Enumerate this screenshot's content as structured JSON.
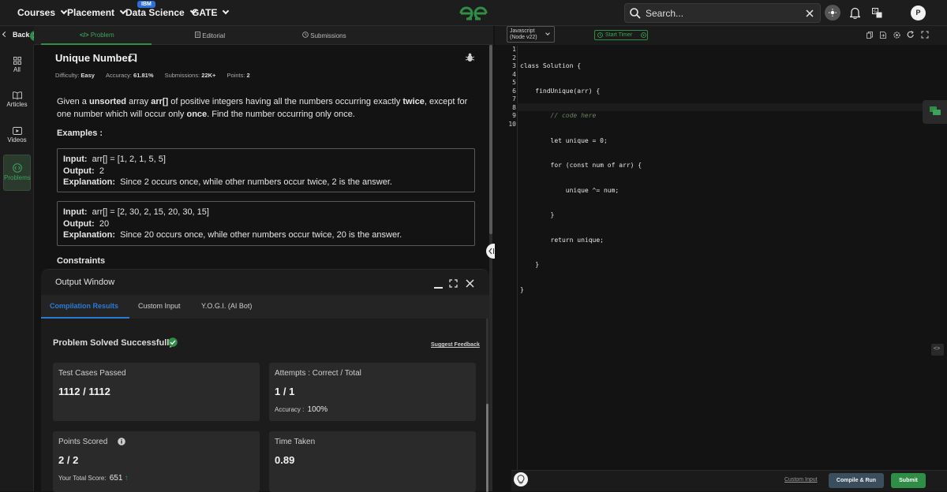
{
  "topnav": {
    "courses": "Courses",
    "placement": "Placement",
    "data_science": "Data Science",
    "ibm_badge": "IBM",
    "gate": "GATE",
    "search_placeholder": "Search...",
    "avatar_initial": "P"
  },
  "rail": {
    "back_label": "Back",
    "items": [
      {
        "label": "All",
        "icon": "grid-icon"
      },
      {
        "label": "Articles",
        "icon": "book-icon"
      },
      {
        "label": "Videos",
        "icon": "video-icon"
      },
      {
        "label": "Problems",
        "icon": "code-icon"
      }
    ]
  },
  "problem_tabs": {
    "problem": "Problem",
    "editorial": "Editorial",
    "submissions": "Submissions"
  },
  "problem": {
    "title": "Unique Number I",
    "difficulty_label": "Difficulty:",
    "difficulty": "Easy",
    "accuracy_label": "Accuracy:",
    "accuracy": "61.81%",
    "submissions_label": "Submissions:",
    "submissions": "22K+",
    "points_label": "Points:",
    "points": "2",
    "desc_1": "Given a ",
    "desc_2": "unsorted",
    "desc_3": " array ",
    "desc_4": "arr[]",
    "desc_5": " of positive integers having all the numbers occurring exactly ",
    "desc_6": "twice",
    "desc_7": ", except for one number which will occur only ",
    "desc_8": "once",
    "desc_9": ". Find the number occurring only once.",
    "examples_heading": "Examples :",
    "examples": [
      {
        "input_label": "Input:",
        "input": "arr[] = [1, 2, 1, 5, 5]",
        "output_label": "Output:",
        "output": "2",
        "explanation_label": "Explanation:",
        "explanation": "Since 2 occurs once, while other numbers occur twice, 2 is the answer."
      },
      {
        "input_label": "Input:",
        "input": "arr[] = [2, 30, 2, 15, 20, 30, 15]",
        "output_label": "Output:",
        "output": "20",
        "explanation_label": "Explanation:",
        "explanation": "Since 20 occurs once, while other numbers occur twice, 20 is the answer."
      }
    ],
    "constraints_heading": "Constraints"
  },
  "output_window": {
    "title": "Output Window",
    "tabs": [
      "Compilation Results",
      "Custom Input",
      "Y.O.G.I. (AI Bot)"
    ],
    "status": "Problem Solved Successfully",
    "suggest_feedback": "Suggest Feedback",
    "test_cases_label": "Test Cases Passed",
    "test_cases_value": "1112 / 1112",
    "attempts_label": "Attempts : Correct / Total",
    "attempts_value": "1 / 1",
    "accuracy_label": "Accuracy :",
    "accuracy_value": "100%",
    "points_label": "Points Scored",
    "points_value": "2 / 2",
    "total_score_label": "Your Total Score:",
    "total_score_value": "651",
    "time_label": "Time Taken",
    "time_value": "0.89"
  },
  "editor": {
    "language": "Javascript",
    "language_version": "(Node v22)",
    "start_timer": "Start Timer",
    "line_numbers": [
      "1",
      "2",
      "3",
      "4",
      "5",
      "6",
      "7",
      "8",
      "9",
      "10"
    ],
    "code_lines": [
      "class Solution {",
      "    findUnique(arr) {",
      "        // code here",
      "        let unique = 0;",
      "        for (const num of arr) {",
      "            unique ^= num;",
      "        }",
      "        return unique;",
      "    }",
      "}"
    ],
    "custom_input": "Custom Input",
    "compile_run": "Compile & Run",
    "submit": "Submit"
  },
  "colors": {
    "brand_green": "#2f8d46",
    "accent_blue": "#2e6ed7",
    "link_blue": "#2b7bd6",
    "bg_dark": "#131313"
  }
}
